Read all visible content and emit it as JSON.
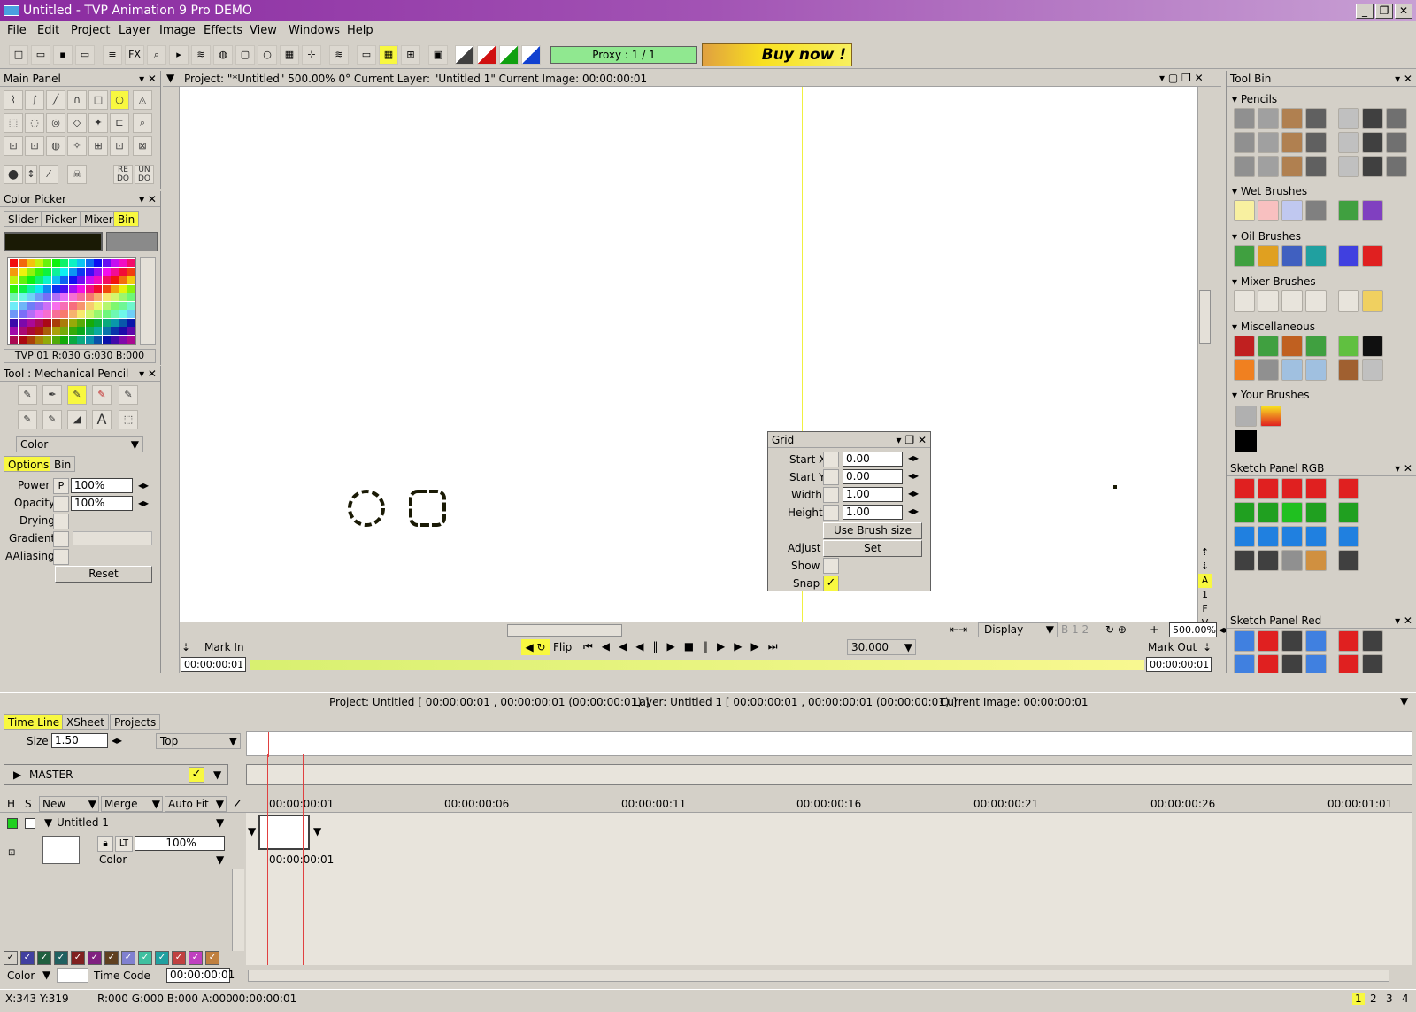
{
  "window": {
    "title": "Untitled - TVP Animation 9 Pro DEMO",
    "min": "_",
    "restore": "❐",
    "close": "✕"
  },
  "menu": [
    "File",
    "Edit",
    "Project",
    "Layer",
    "Image",
    "Effects",
    "View",
    "Windows",
    "Help"
  ],
  "toolbar": {
    "proxy": "Proxy : 1 / 1",
    "buy_now": "Buy now !",
    "fx": "FX"
  },
  "main_panel": {
    "title": "Main Panel",
    "redo": "RE DO",
    "undo": "UN DO"
  },
  "color_picker": {
    "title": "Color Picker",
    "tabs": [
      "Slider",
      "Picker",
      "Mixer",
      "Bin"
    ],
    "active_tab": "Bin",
    "primary_color": "#1a1a05",
    "secondary_color": "#8a8a8a",
    "info": "TVP 01 R:030 G:030 B:000"
  },
  "tool_panel": {
    "title": "Tool : Mechanical Pencil",
    "mode": "Color",
    "tabs": [
      "Options",
      "Bin"
    ],
    "power_label": "Power",
    "power_p": "P",
    "power_value": "100%",
    "opacity_label": "Opacity",
    "opacity_value": "100%",
    "drying_label": "Drying",
    "gradient_label": "Gradient",
    "aaliasing_label": "AAliasing",
    "reset": "Reset"
  },
  "project_bar": {
    "text": "Project:  \"*Untitled\"   500.00%   0°  Current Layer: \"Untitled 1\"   Current Image: 00:00:00:01"
  },
  "grid_dialog": {
    "title": "Grid",
    "start_x_label": "Start X",
    "start_x": "0.00",
    "start_y_label": "Start Y",
    "start_y": "0.00",
    "width_label": "Width",
    "width": "1.00",
    "height_label": "Height",
    "height": "1.00",
    "use_brush": "Use Brush size",
    "adjust_label": "Adjust",
    "set": "Set",
    "show_label": "Show",
    "snap_label": "Snap",
    "snap_on": true
  },
  "playback": {
    "mark_in": "Mark In",
    "flip": "Flip",
    "fps": "30.000",
    "mark_out": "Mark Out",
    "display": "Display",
    "zoom": "500.00%",
    "time_in": "00:00:00:01",
    "time_out": "00:00:00:01",
    "side_buttons": [
      "A",
      "1",
      "F",
      "V"
    ],
    "pages": [
      "1",
      "2"
    ]
  },
  "timeline_info": {
    "project": "Project: Untitled [ 00:00:00:01 , 00:00:00:01  (00:00:00:01) ]",
    "layer": "Layer: Untitled 1 [ 00:00:00:01 , 00:00:00:01  (00:00:00:01) ]",
    "current": "Current Image: 00:00:00:01"
  },
  "timeline": {
    "tabs": [
      "Time Line",
      "XSheet",
      "Projects"
    ],
    "active_tab": "Time Line",
    "size_label": "Size",
    "size_value": "1.50",
    "position": "Top",
    "master": "MASTER",
    "col_h": "H",
    "col_s": "S",
    "new": "New",
    "merge": "Merge",
    "autofit": "Auto Fit",
    "z": "Z",
    "ruler": [
      "00:00:00:01",
      "00:00:00:06",
      "00:00:00:11",
      "00:00:00:16",
      "00:00:00:21",
      "00:00:00:26",
      "00:00:01:01"
    ],
    "layer_name": "Untitled 1",
    "layer_opacity": "100%",
    "layer_lt": "LT",
    "layer_mode": "Color",
    "cel_time": "00:00:00:01",
    "bottom_color": "Color",
    "time_code_label": "Time Code",
    "time_code": "00:00:00:01"
  },
  "tool_bin": {
    "title": "Tool Bin",
    "groups": [
      "Pencils",
      "Wet Brushes",
      "Oil Brushes",
      "Mixer Brushes",
      "Miscellaneous",
      "Your Brushes"
    ]
  },
  "sketch_rgb": {
    "title": "Sketch Panel RGB"
  },
  "sketch_red": {
    "title": "Sketch Panel Red"
  },
  "status": {
    "coords": "X:343  Y:319",
    "rgba": "R:000 G:000 B:000 A:000",
    "time": "00:00:00:01",
    "pages": [
      "1",
      "2",
      "3",
      "4"
    ]
  }
}
